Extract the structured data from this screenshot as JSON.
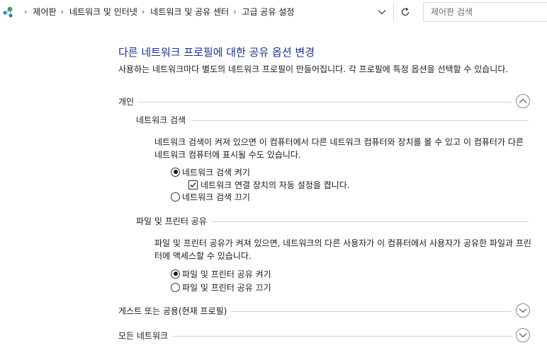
{
  "address_bar": {
    "icon": "control-panel-icon",
    "breadcrumbs": [
      "제어판",
      "네트워크 및 인터넷",
      "네트워크 및 공유 센터",
      "고급 공유 설정"
    ],
    "search_placeholder": "제어판 검색"
  },
  "page": {
    "title": "다른 네트워크 프로필에 대한 공유 옵션 변경",
    "subtitle": "사용하는 네트워크마다 별도의 네트워크 프로필이 만들어집니다. 각 프로필에 특정 옵션을 선택할 수 있습니다."
  },
  "sections": {
    "private": {
      "label": "개인",
      "expanded": true,
      "network_discovery": {
        "label": "네트워크 검색",
        "description": "네트워크 검색이 켜져 있으면 이 컴퓨터에서 다른 네트워크 컴퓨터와 장치를 볼 수 있고 이 컴퓨터가 다른 네트워크 컴퓨터에 표시될 수도 있습니다.",
        "on_label": "네트워크 검색 켜기",
        "auto_setup_label": "네트워크 연결 장치의 자동 설정을 켭니다.",
        "auto_setup_checked": true,
        "off_label": "네트워크 검색 끄기",
        "selected": "on"
      },
      "file_printer_sharing": {
        "label": "파일 및 프린터 공유",
        "description": "파일 및 프린터 공유가 켜져 있으면, 네트워크의 다른 사용자가 이 컴퓨터에서 사용자가 공유한 파일과 프린터에 액세스할 수 있습니다.",
        "on_label": "파일 및 프린터 공유 켜기",
        "off_label": "파일 및 프린터 공유 끄기",
        "selected": "on"
      }
    },
    "guest_public": {
      "label": "게스트 또는 공용(현재 프로필)",
      "expanded": false
    },
    "all_networks": {
      "label": "모든 네트워크",
      "expanded": false
    }
  },
  "colors": {
    "title": "#1e3287",
    "rule": "#cfcfcf"
  }
}
